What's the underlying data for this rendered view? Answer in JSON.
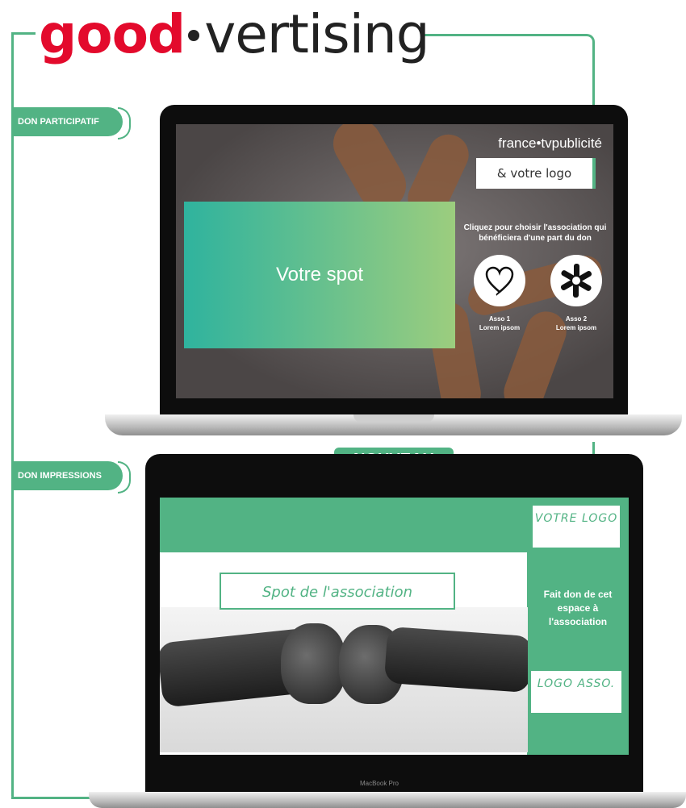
{
  "brand": {
    "logo_good": "good",
    "logo_rest": "vertising",
    "logo_full": "good•vertising"
  },
  "tags": {
    "don_participatif": "DON PARTICIPATIF",
    "don_impressions": "DON IMPRESSIONS"
  },
  "laptop1": {
    "francetv": "france•tvpublicité",
    "votre_logo": "& votre logo",
    "spot": "Votre spot",
    "choose_text": "Cliquez pour choisir l'association qui bénéficiera d'une part du don",
    "asso1": {
      "name": "Asso 1",
      "sub": "Lorem ipsom",
      "icon": "heart-icon"
    },
    "asso2": {
      "name": "Asso 2",
      "sub": "Lorem ipsom",
      "icon": "hands-circle-icon"
    }
  },
  "badge_new": "NOUVEAU",
  "laptop2": {
    "votre_logo": "VOTRE LOGO",
    "spot": "Spot de l'association",
    "donate": "Fait don de cet espace à l'association",
    "logo_asso": "LOGO ASSO.",
    "device_label": "MacBook Pro"
  },
  "colors": {
    "green": "#52b384",
    "red": "#e30a2c"
  }
}
